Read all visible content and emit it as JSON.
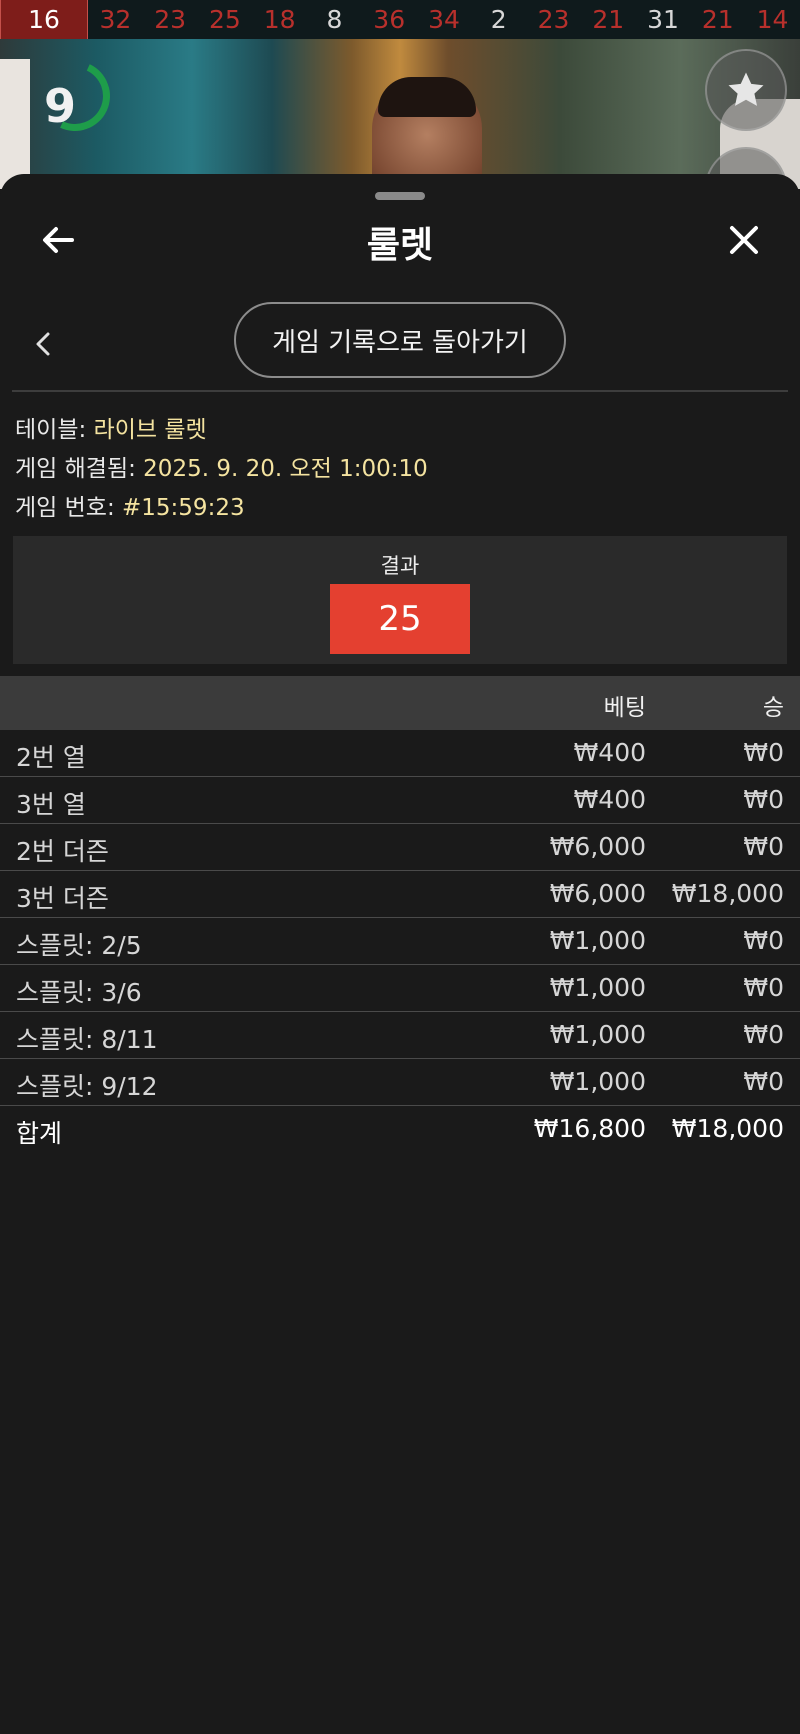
{
  "results_strip": {
    "numbers": [
      {
        "value": "16",
        "color": "first"
      },
      {
        "value": "32",
        "color": "red"
      },
      {
        "value": "23",
        "color": "red"
      },
      {
        "value": "25",
        "color": "red"
      },
      {
        "value": "18",
        "color": "red"
      },
      {
        "value": "8",
        "color": "black"
      },
      {
        "value": "36",
        "color": "red"
      },
      {
        "value": "34",
        "color": "red"
      },
      {
        "value": "2",
        "color": "black"
      },
      {
        "value": "23",
        "color": "red"
      },
      {
        "value": "21",
        "color": "red"
      },
      {
        "value": "31",
        "color": "black"
      },
      {
        "value": "21",
        "color": "red"
      },
      {
        "value": "14",
        "color": "red"
      }
    ]
  },
  "timer": {
    "value": "9"
  },
  "header": {
    "title": "룰렛"
  },
  "nav": {
    "return_label": "게임 기록으로 돌아가기"
  },
  "info": {
    "table_label": "테이블: ",
    "table_value": "라이브 룰렛",
    "resolved_label": "게임 해결됨: ",
    "resolved_value": "2025. 9. 20. 오전 1:00:10",
    "number_label": "게임 번호: ",
    "number_value": "#15:59:23"
  },
  "result": {
    "label": "결과",
    "number": "25",
    "color": "#e44030"
  },
  "bets": {
    "col_bet": "베팅",
    "col_win": "승",
    "rows": [
      {
        "name": "2번 열",
        "bet": "₩400",
        "win": "₩0"
      },
      {
        "name": "3번 열",
        "bet": "₩400",
        "win": "₩0"
      },
      {
        "name": "2번 더즌",
        "bet": "₩6,000",
        "win": "₩0"
      },
      {
        "name": "3번 더즌",
        "bet": "₩6,000",
        "win": "₩18,000"
      },
      {
        "name": "스플릿: 2/5",
        "bet": "₩1,000",
        "win": "₩0"
      },
      {
        "name": "스플릿: 3/6",
        "bet": "₩1,000",
        "win": "₩0"
      },
      {
        "name": "스플릿: 8/11",
        "bet": "₩1,000",
        "win": "₩0"
      },
      {
        "name": "스플릿: 9/12",
        "bet": "₩1,000",
        "win": "₩0"
      }
    ],
    "total": {
      "name": "합계",
      "bet": "₩16,800",
      "win": "₩18,000"
    }
  }
}
